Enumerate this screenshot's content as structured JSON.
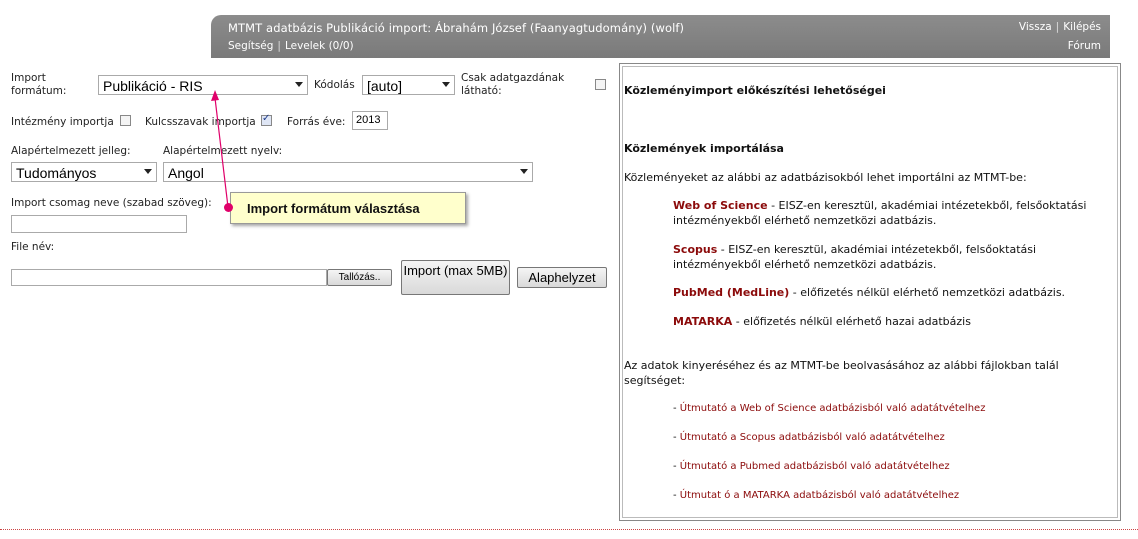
{
  "header": {
    "title": "MTMT adatbázis Publikáció import: Ábrahám József (Faanyagtudomány) (wolf)",
    "links": [
      "Segítség",
      "Levelek (0/0)"
    ],
    "right_links": [
      "Vissza",
      "Kilépés"
    ],
    "forum": "Fórum"
  },
  "form": {
    "import_format_label": "Import formátum:",
    "import_format_value": "Publikáció - RIS",
    "encoding_label": "Kódolás",
    "encoding_value": "[auto]",
    "owner_visible_label": "Csak adatgazdának látható:",
    "institution_import_label": "Intézmény importja",
    "keywords_import_label": "Kulcsszavak importja",
    "source_year_label": "Forrás éve:",
    "source_year_value": "2013",
    "default_type_label": "Alapértelmezett jelleg:",
    "default_type_value": "Tudományos",
    "default_lang_label": "Alapértelmezett nyelv:",
    "default_lang_value": "Angol",
    "package_name_label": "Import csomag neve (szabad szöveg):",
    "package_name_value": "",
    "file_label": "File név:",
    "file_value": "",
    "browse_button": "Tallózás..",
    "import_button": "Import (max 5MB)",
    "reset_button": "Alaphelyzet",
    "checkboxes": {
      "owner_visible": false,
      "institution_import": false,
      "keywords_import": true
    }
  },
  "tooltip": {
    "text": "Import formátum választása",
    "color": "#e0006a"
  },
  "panel": {
    "heading1": "Közleményimport előkészítési lehetőségei",
    "heading2": "Közlemények importálása",
    "intro": "Közleményeket az alábbi az adatbázisokból lehet importálni az MTMT-be:",
    "sources": [
      {
        "name": "Web of Science",
        "desc": " - EISZ-en keresztül, akadémiai intézetekből, felsőoktatási intézményekből elérhető nemzetközi adatbázis."
      },
      {
        "name": "Scopus",
        "desc": " - EISZ-en keresztül, akadémiai intézetekből, felsőoktatási intézményekből elérhető nemzetközi adatbázis."
      },
      {
        "name": "PubMed (MedLine)",
        "desc": " - előfizetés nélkül elérhető nemzetközi adatbázis."
      },
      {
        "name": "MATARKA",
        "desc": " - előfizetés nélkül elérhető hazai adatbázis"
      }
    ],
    "help_text": "Az adatok kinyeréséhez és az MTMT-be beolvasásához az alábbi fájlokban talál segítséget:",
    "guides": [
      "Útmutató a Web of Science adatbázisból való adatátvételhez",
      "Útmutató a Scopus adatbázisból való adatátvételhez",
      "Útmutató a Pubmed adatbázisból való adatátvételhez",
      "Útmutat ó a MATARKA adatbázisból való adatátvételhez"
    ]
  }
}
